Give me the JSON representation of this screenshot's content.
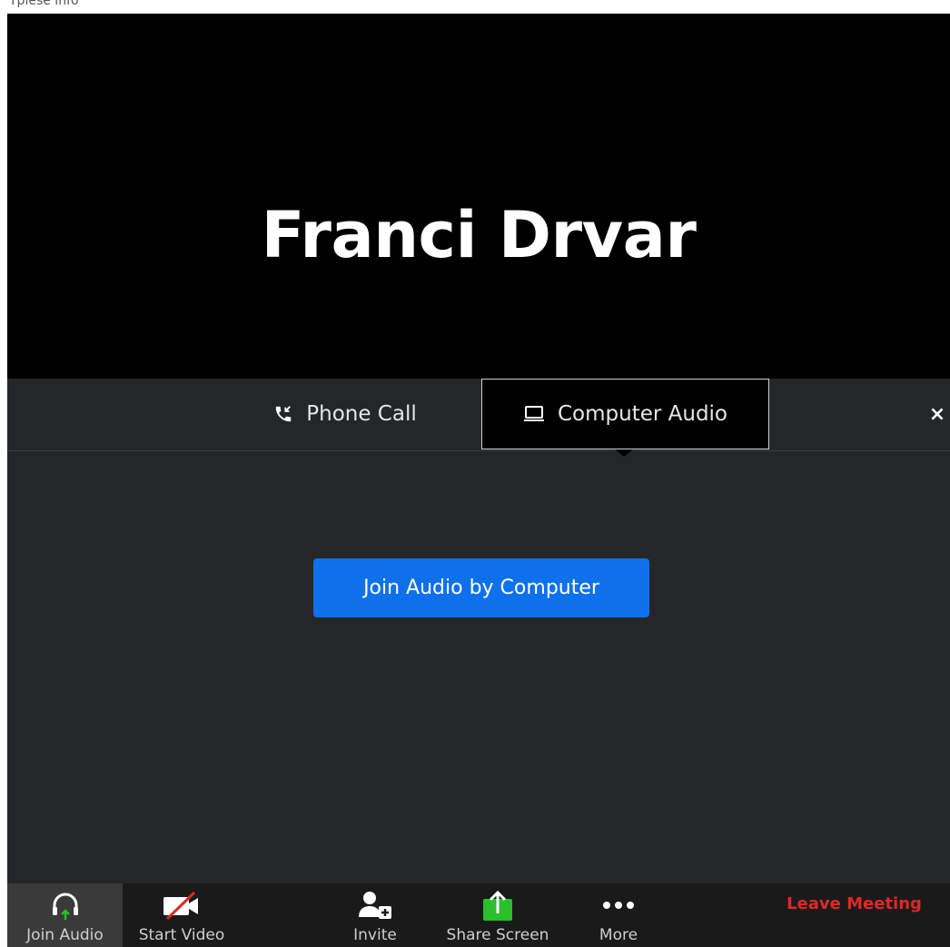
{
  "page": {
    "top_text": "Tplese info"
  },
  "video": {
    "participant_name": "Franci Drvar"
  },
  "audio_dialog": {
    "tabs": [
      {
        "label": "Phone Call",
        "icon": "phone-incoming-icon",
        "selected": false
      },
      {
        "label": "Computer Audio",
        "icon": "laptop-icon",
        "selected": true
      }
    ],
    "close_label": "×",
    "join_button": "Join Audio by Computer"
  },
  "toolbar": {
    "items": [
      {
        "label": "Join Audio",
        "icon": "headphones-icon"
      },
      {
        "label": "Start Video",
        "icon": "video-off-icon"
      },
      {
        "label": "Invite",
        "icon": "add-user-icon"
      },
      {
        "label": "Share Screen",
        "icon": "share-screen-icon"
      },
      {
        "label": "More",
        "icon": "more-icon"
      }
    ],
    "leave_label": "Leave Meeting"
  },
  "colors": {
    "accent_blue": "#0e71eb",
    "share_green": "#29c029",
    "leave_red": "#e02828",
    "panel_bg": "#252628",
    "video_bg": "#000000"
  }
}
